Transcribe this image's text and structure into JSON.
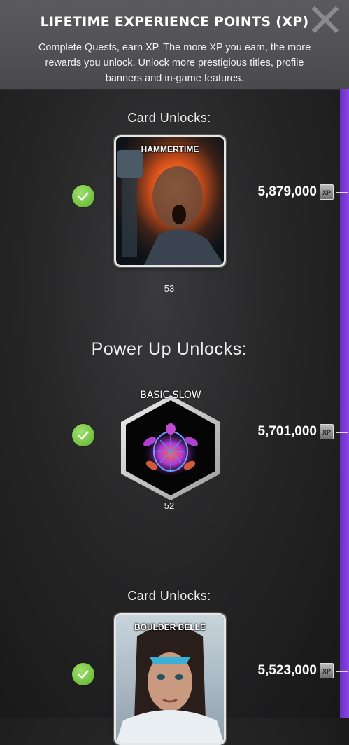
{
  "header": {
    "title": "LIFETIME EXPERIENCE POINTS (XP)",
    "subtitle": "Complete Quests, earn XP. The more XP you earn, the more rewards you unlock. Unlock more prestigious titles, profile banners and in-game features."
  },
  "xp_badge_label": "XP",
  "unlocks": [
    {
      "section": "Card Unlocks:",
      "name": "HAMMERTIME",
      "level": "53",
      "xp": "5,879,000",
      "completed": true
    },
    {
      "section": "Power Up Unlocks:",
      "name": "BASIC SLOW",
      "level": "52",
      "xp": "5,701,000",
      "completed": true
    },
    {
      "section": "Card Unlocks:",
      "name": "BOULDER BELLE",
      "xp": "5,523,000",
      "completed": true
    }
  ],
  "colors": {
    "track": "#7a3ad8",
    "check": "#74c43c"
  }
}
